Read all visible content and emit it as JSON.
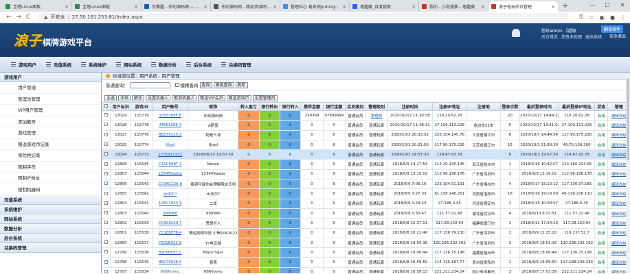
{
  "browser": {
    "tabs": [
      {
        "title": "宝塔Linux面板",
        "color": "#2e8b57"
      },
      {
        "title": "宝塔Linux面板",
        "color": "#2e8b57"
      },
      {
        "title": "仅赛趣 - 乐则源码网 — Wo",
        "color": "#1e5fa8"
      },
      {
        "title": "乐则源码网 - 精品资源网站乐",
        "color": "#555555"
      },
      {
        "title": "管理中心 易名网Juming.Co",
        "color": "#3a8ee6"
      },
      {
        "title": "堵趣魔_百度搜索",
        "color": "#2962ff"
      },
      {
        "title": "我的 - 小说搜索 - 堵趣魔",
        "color": "#c0392b"
      },
      {
        "title": "浪子电玩后台管理",
        "color": "#c0392b",
        "active": true
      }
    ],
    "new_tab": "+",
    "back": "←",
    "forward": "→",
    "reload": "C",
    "security": "不安全",
    "url": "27.50.161.253:81/Index.aspx"
  },
  "banner": {
    "logo_big": "浪子",
    "logo_small": "棋牌游戏平台",
    "user_line1": "您好admin 【超级",
    "user_line2": [
      "后台首页",
      "您有未处理",
      "退出系统"
    ],
    "ext_badge": "翻译插件",
    "safe": "安全退出"
  },
  "menu": [
    "游戏用户",
    "充值系统",
    "系统维护",
    "网站系统",
    "数据分析",
    "后台系统",
    "兑换码管理"
  ],
  "sidebar": {
    "header": "游戏用户",
    "items": [
      "用户管理",
      "管理员管理",
      "VIP用户管理",
      "添加靓号",
      "游戏管理",
      "赠送游戏币记录",
      "保险柜记录",
      "限制字符",
      "限制IP地址",
      "限制机器码"
    ],
    "groups": [
      "充值系统",
      "系统维护",
      "网站系统",
      "数据分析",
      "后台系统",
      "兑换码管理"
    ]
  },
  "breadcrumb": "你当前位置：用户系统 - 用户管理",
  "search": {
    "label": "普通查询：",
    "fuzzy": "模糊查询",
    "btn_query": "查询",
    "btn_adv": "高级查询",
    "btn_refresh": "刷新"
  },
  "actions": [
    "全选",
    "冻结",
    "解冻",
    "设置机器人",
    "取消机器人",
    "赠送VIP会员",
    "赠送游戏币",
    "设置管理员"
  ],
  "table": {
    "headers": [
      "",
      "用户标识",
      "游戏ID",
      "用户账号",
      "昵称",
      "转入盈亏",
      "银行转出",
      "银行转入",
      "携带金额",
      "银行金额",
      "会员级别",
      "管理级别",
      "注册时间",
      "注册IP地址",
      "注册地",
      "登录次数",
      "最后登录时间",
      "最后登录IP地址",
      "状态",
      "管理"
    ],
    "rows": [
      [
        "",
        "13029",
        "115779",
        "1055368F E",
        "乐则源码网",
        "0",
        "0",
        "0",
        "239368",
        "97999999",
        "普通会员",
        "管理员",
        "2020/10/17 11:30:58",
        "116.20.62.28",
        "",
        "20",
        "2020/10/17 14:44:22",
        "116.20.62.28",
        "启用",
        "编辑冻结"
      ],
      [
        "",
        "13028",
        "115778",
        "4TE6108E 3",
        "A斯堡",
        "0",
        "0",
        "0",
        "0",
        "0",
        "普通会员",
        "普通玩家",
        "2020/10/17 11:48:32",
        "27.109.113.228",
        "金边省21市",
        "5",
        "2020/10/17 13:41:02",
        "27.109.113.228",
        "启用",
        "编辑冻结"
      ],
      [
        "",
        "13027",
        "115776",
        "RB279115 2",
        "物是人非",
        "0",
        "0",
        "0",
        "0",
        "0",
        "普通会员",
        "普通玩家",
        "2020/10/3 20:33:52",
        "223.104.145.76",
        "江苏省镇江市",
        "6",
        "2020/10/7 14:44:54",
        "117.90.175.226",
        "启用",
        "编辑冻结"
      ],
      [
        "",
        "13025",
        "115774",
        "fjlyql",
        "fjlyql",
        "0",
        "0",
        "0",
        "0",
        "0",
        "普通会员",
        "普通玩家",
        "2020/10/3 20:21:56",
        "117.90.175.226",
        "江苏省镇江市",
        "15",
        "2020/10/3 21:58:39",
        "49.70.100.200",
        "启用",
        "编辑冻结"
      ],
      [
        "",
        "13024",
        "115773",
        "17T5912111",
        "2018/06/13 19:57:30",
        "0",
        "0",
        "0",
        "0",
        "0",
        "普通会员",
        "普通玩家",
        "2020/10/3 19:57:30",
        "114.67.93.78",
        "",
        "0",
        "2020/10/3 19:57:30",
        "114.67.93.78",
        "启用",
        "编辑冻结"
      ],
      [
        "",
        "12808",
        "115545",
        "C4AC998T 2",
        "Naven",
        "0",
        "0",
        "0",
        "0",
        "0",
        "普通会员",
        "普通玩家",
        "2018/6/9 14:17:54",
        "112.10.195.145",
        "浙江省杭州市",
        "1",
        "2018/6/16 10:42:07",
        "124.160.213.66",
        "启用",
        "编辑冻结"
      ],
      [
        "",
        "12807",
        "115544",
        "123456aaba",
        "123456aaba",
        "0",
        "0",
        "0",
        "0",
        "0",
        "普通会员",
        "普通玩家",
        "2018/6/9 13:19:02",
        "112.96.196.176",
        "广东省深圳市",
        "1",
        "2018/6/9 13:19:02",
        "112.96.196.176",
        "启用",
        "编辑冻结"
      ],
      [
        "",
        "12806",
        "115543",
        "CC9AC228 8",
        "瓶颈可能你会理解我这乐则",
        "0",
        "0",
        "0",
        "0",
        "0",
        "普通会员",
        "普通玩家",
        "2018/6/9 7:06:10",
        "223.104.91.191",
        "广东省梅州市",
        "4",
        "2018/6/17 15:13:12",
        "117.136.97.185",
        "启用",
        "编辑冻结"
      ],
      [
        "",
        "12805",
        "115542",
        "dr法尔?",
        "dr法尔?",
        "0",
        "0",
        "0",
        "0",
        "0",
        "普通会员",
        "普通玩家",
        "2018/6/9 3:27:33",
        "61.158.146.251",
        "河南省洛阳市",
        "18",
        "2018/6/16 19:19:09",
        "49.119.226.110",
        "启用",
        "编辑冻结"
      ],
      [
        "",
        "12804",
        "115541",
        "10EC7033 1",
        "二哥",
        "0",
        "0",
        "0",
        "0",
        "0",
        "普通会员",
        "普通玩家",
        "2018/6/9 1:24:43",
        "27.186.0.45",
        "河北省保定市",
        "1",
        "2018/6/15 10:28:57",
        "27.186.0.45",
        "启用",
        "编辑冻结"
      ],
      [
        "",
        "12803",
        "115540",
        "999966",
        "999966",
        "0",
        "0",
        "0",
        "0",
        "0",
        "普通会员",
        "普通玩家",
        "2018/6/9 0:30:47",
        "111.57.22.48",
        "湖北省武汉市",
        "4",
        "2018/6/13 8:32:51",
        "111.57.22.48",
        "启用",
        "编辑冻结"
      ],
      [
        "",
        "12802",
        "115539",
        "CC509229 7",
        "思想巨人",
        "0",
        "0",
        "0",
        "0",
        "0",
        "普通会员",
        "普通玩家",
        "2018/6/8 22:37:11",
        "117.28.150.94",
        "福建省厦门市",
        "1",
        "2018/6/11 17:24:10",
        "117.28.150.94",
        "启用",
        "编辑冻结"
      ],
      [
        "",
        "12801",
        "115538",
        "7C1EBEF6 4",
        "联运网络科技 小辑1062022",
        "0",
        "0",
        "0",
        "0",
        "0",
        "普通会员",
        "普通玩家",
        "2018/6/8 20:22:46",
        "117.136.79.130",
        "广东省深圳市",
        "2",
        "2018/6/9 12:25:20",
        "119.137.52.7",
        "启用",
        "编辑冻结"
      ],
      [
        "",
        "12800",
        "115537",
        "F831B932 8",
        "T?电玩城",
        "0",
        "0",
        "0",
        "0",
        "0",
        "普通会员",
        "普通玩家",
        "2018/6/8 18:50:38",
        "120.236.232.162",
        "广东省深圳市",
        "3",
        "2018/6/8 18:51:16",
        "120.236.232.162",
        "启用",
        "编辑冻结"
      ],
      [
        "",
        "12799",
        "115536",
        "8905EB57 C",
        "Black tiger",
        "0",
        "0",
        "0",
        "0",
        "0",
        "普通会员",
        "普通玩家",
        "2018/6/8 18:06:44",
        "117.136.75.198",
        "福建省福州市",
        "1",
        "2018/6/8 18:06:44",
        "117.136.75.198",
        "启用",
        "编辑冻结"
      ],
      [
        "",
        "12798",
        "115535",
        "8B279536 F",
        "喜喜",
        "0",
        "0",
        "0",
        "0",
        "0",
        "普通会员",
        "普通玩家",
        "2018/6/8 16:59:50",
        "114.135.187.77",
        "贵州省贵阳市",
        "1",
        "2018/6/8 16:59:50",
        "117.188.238.234",
        "启用",
        "编辑冻结"
      ],
      [
        "",
        "12797",
        "115534",
        "6666vvvv",
        "6666vvvv",
        "0",
        "0",
        "0",
        "0",
        "0",
        "普通会员",
        "普通玩家",
        "2018/6/8 16:58:13",
        "222.211.234.24",
        "四川省成都市",
        "3",
        "2018/6/8 17:03:39",
        "222.211.234.24",
        "启用",
        "编辑冻结"
      ]
    ]
  }
}
